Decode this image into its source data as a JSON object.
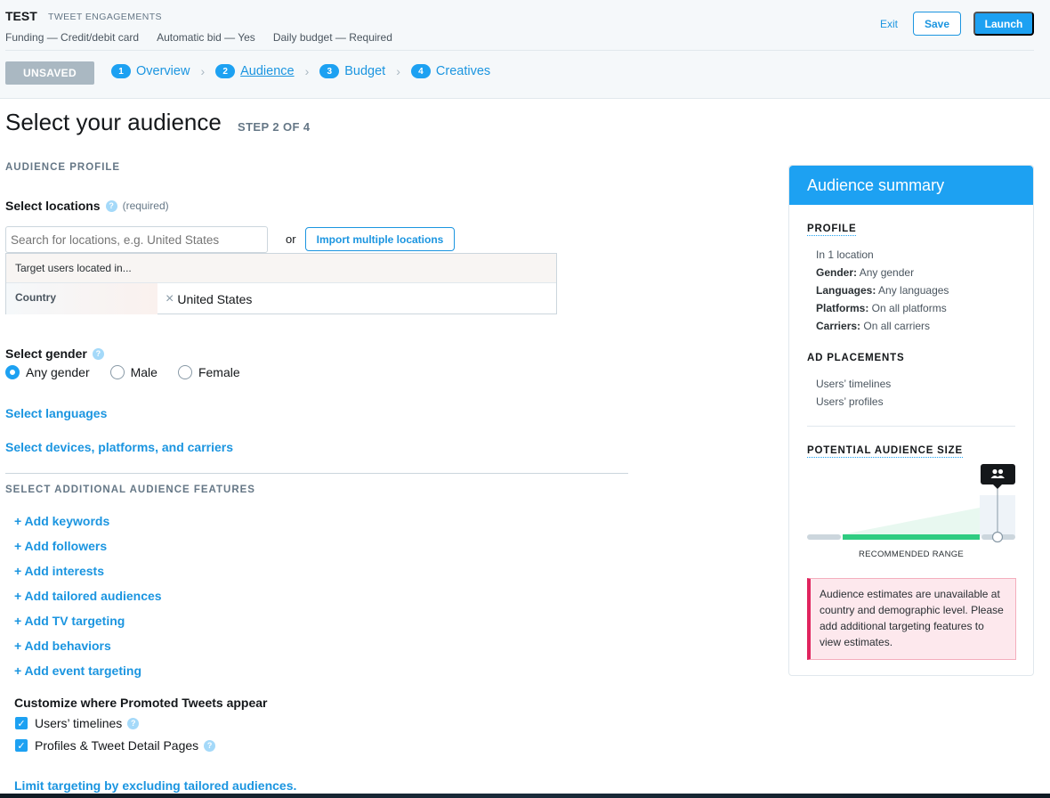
{
  "header": {
    "campaign_name": "TEST",
    "objective": "TWEET ENGAGEMENTS",
    "meta": [
      "Funding — Credit/debit card",
      "Automatic bid — Yes",
      "Daily budget — Required"
    ],
    "exit_label": "Exit",
    "save_label": "Save",
    "launch_label": "Launch",
    "status": "UNSAVED",
    "steps": [
      {
        "num": "1",
        "label": "Overview"
      },
      {
        "num": "2",
        "label": "Audience"
      },
      {
        "num": "3",
        "label": "Budget"
      },
      {
        "num": "4",
        "label": "Creatives"
      }
    ]
  },
  "main": {
    "title": "Select your audience",
    "step_of": "STEP 2 OF 4",
    "profile_section": "AUDIENCE PROFILE",
    "locations_label": "Select locations",
    "required_label": "(required)",
    "location_placeholder": "Search for locations, e.g. United States",
    "or_label": "or",
    "import_label": "Import multiple locations",
    "target_heading": "Target users located in...",
    "country_label": "Country",
    "country_value": "United States",
    "gender_label": "Select gender",
    "gender_options": [
      "Any gender",
      "Male",
      "Female"
    ],
    "languages_link": "Select languages",
    "devices_link": "Select devices, platforms, and carriers",
    "additional_section": "SELECT ADDITIONAL AUDIENCE FEATURES",
    "add_links": [
      "+ Add keywords",
      "+ Add followers",
      "+ Add interests",
      "+ Add tailored audiences",
      "+ Add TV targeting",
      "+ Add behaviors",
      "+ Add event targeting"
    ],
    "customize_label": "Customize where Promoted Tweets appear",
    "placements": [
      "Users’ timelines",
      "Profiles & Tweet Detail Pages"
    ],
    "exclude_link": "Limit targeting by excluding tailored audiences."
  },
  "summary": {
    "title": "Audience summary",
    "profile_heading": "PROFILE",
    "location_line": "In 1 location",
    "gender_key": "Gender:",
    "gender_val": " Any gender",
    "languages_key": "Languages:",
    "languages_val": " Any languages",
    "platforms_key": "Platforms:",
    "platforms_val": " On all platforms",
    "carriers_key": "Carriers:",
    "carriers_val": " On all carriers",
    "placements_heading": "AD PLACEMENTS",
    "placements": [
      "Users’ timelines",
      "Users’ profiles"
    ],
    "size_heading": "POTENTIAL AUDIENCE SIZE",
    "range_label": "RECOMMENDED RANGE",
    "warning": "Audience estimates are unavailable at country and demographic level. Please add additional targeting features to view estimates."
  },
  "colors": {
    "accent": "#1da1f2",
    "link": "#1b95e0",
    "range_green": "#2fcc81",
    "warning_border": "#e0245e"
  }
}
